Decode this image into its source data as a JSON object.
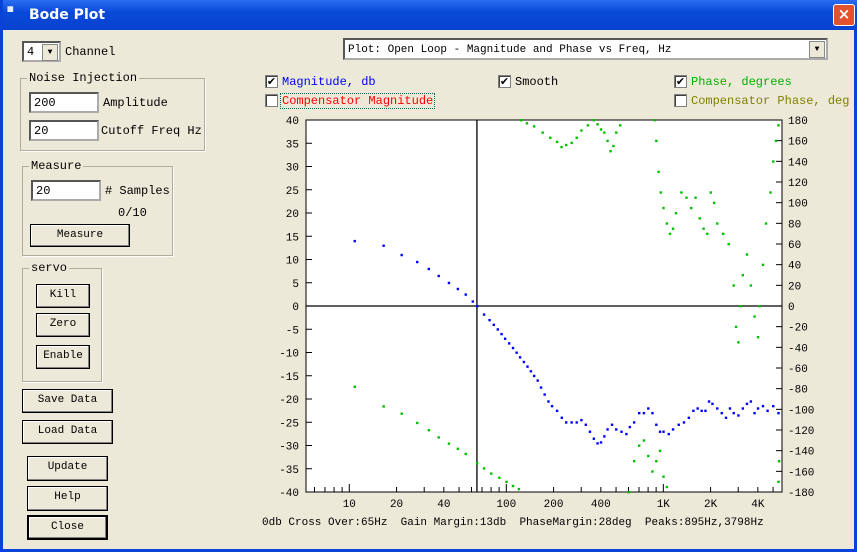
{
  "window": {
    "title": "Bode Plot",
    "icon": "app-icon",
    "close": "×"
  },
  "channel": {
    "value": "4",
    "label": "Channel"
  },
  "noise": {
    "title": "Noise Injection",
    "amplitude": "200",
    "amplitude_label": "Amplitude",
    "cutoff": "20",
    "cutoff_label": "Cutoff Freq Hz"
  },
  "measure": {
    "title": "Measure",
    "samples": "20",
    "samples_label": "# Samples",
    "progress": "0/10",
    "button": "Measure"
  },
  "servo": {
    "title": "servo",
    "kill": "Kill",
    "zero": "Zero",
    "enable": "Enable"
  },
  "buttons": {
    "save": "Save Data",
    "load": "Load Data",
    "update": "Update",
    "help": "Help",
    "close": "Close"
  },
  "plot_select": "Plot: Open Loop - Magnitude and Phase vs Freq, Hz",
  "checks": {
    "magnitude": {
      "label": "Magnitude, db",
      "checked": true,
      "color": "#0000ff"
    },
    "smooth": {
      "label": "Smooth",
      "checked": true,
      "color": "#000000"
    },
    "phase": {
      "label": "Phase, degrees",
      "checked": true,
      "color": "#00b000"
    },
    "comp_mag": {
      "label": "Compensator Magnitude",
      "checked": false,
      "color": "#ff0000"
    },
    "comp_phase": {
      "label": "Compensator Phase, deg",
      "checked": false,
      "color": "#808000"
    }
  },
  "status": "0db Cross Over:65Hz  Gain Margin:13db  PhaseMargin:28deg  Peaks:895Hz,3798Hz",
  "chart_data": {
    "type": "scatter",
    "x_scale": "log",
    "xlim": [
      5.3,
      5700
    ],
    "y_left": {
      "range": [
        -40,
        40
      ],
      "ticks": [
        40,
        35,
        30,
        25,
        20,
        15,
        10,
        5,
        0,
        -5,
        -10,
        -15,
        -20,
        -25,
        -30,
        -35,
        -40
      ]
    },
    "y_right": {
      "range": [
        -180,
        180
      ],
      "ticks": [
        180,
        160,
        140,
        120,
        100,
        80,
        60,
        40,
        20,
        0,
        -20,
        -40,
        -60,
        -80,
        -100,
        -120,
        -140,
        -160,
        -180
      ]
    },
    "x_ticks": [
      {
        "v": 10,
        "l": "10"
      },
      {
        "v": 20,
        "l": "20"
      },
      {
        "v": 40,
        "l": "40"
      },
      {
        "v": 100,
        "l": "100"
      },
      {
        "v": 200,
        "l": "200"
      },
      {
        "v": 400,
        "l": "400"
      },
      {
        "v": 1000,
        "l": "1K"
      },
      {
        "v": 2000,
        "l": "2K"
      },
      {
        "v": 4000,
        "l": "4K"
      }
    ],
    "crosshair": {
      "x": 65,
      "y": 0
    },
    "series": [
      {
        "axis": "left",
        "color": "#0000ff",
        "points": [
          [
            10.8,
            14
          ],
          [
            16.5,
            13
          ],
          [
            21.5,
            11
          ],
          [
            27,
            9.5
          ],
          [
            32,
            8
          ],
          [
            37,
            6.5
          ],
          [
            43,
            5
          ],
          [
            49,
            3.7
          ],
          [
            55,
            2.5
          ],
          [
            61,
            1
          ],
          [
            65,
            0
          ],
          [
            72,
            -1.8
          ],
          [
            78,
            -3
          ],
          [
            83,
            -4
          ],
          [
            88,
            -5
          ],
          [
            93,
            -6
          ],
          [
            98,
            -7
          ],
          [
            104,
            -8
          ],
          [
            110,
            -9
          ],
          [
            116,
            -10
          ],
          [
            122,
            -11
          ],
          [
            129,
            -12
          ],
          [
            136,
            -13
          ],
          [
            143,
            -14
          ],
          [
            150,
            -15
          ],
          [
            158,
            -16
          ],
          [
            166,
            -17.5
          ],
          [
            175,
            -19
          ],
          [
            185,
            -20.5
          ],
          [
            195,
            -21.5
          ],
          [
            210,
            -22.5
          ],
          [
            225,
            -24
          ],
          [
            240,
            -25
          ],
          [
            260,
            -25
          ],
          [
            280,
            -25
          ],
          [
            300,
            -24.5
          ],
          [
            320,
            -25.5
          ],
          [
            340,
            -27
          ],
          [
            360,
            -28.5
          ],
          [
            380,
            -29.5
          ],
          [
            400,
            -29.3
          ],
          [
            420,
            -28
          ],
          [
            440,
            -26.5
          ],
          [
            470,
            -25.5
          ],
          [
            500,
            -26.5
          ],
          [
            540,
            -27
          ],
          [
            580,
            -27.5
          ],
          [
            610,
            -26
          ],
          [
            650,
            -25
          ],
          [
            700,
            -23
          ],
          [
            750,
            -23
          ],
          [
            800,
            -22
          ],
          [
            850,
            -23
          ],
          [
            900,
            -25.5
          ],
          [
            950,
            -27
          ],
          [
            1000,
            -27
          ],
          [
            1080,
            -27.5
          ],
          [
            1150,
            -26.5
          ],
          [
            1250,
            -25.5
          ],
          [
            1350,
            -25
          ],
          [
            1450,
            -24
          ],
          [
            1550,
            -22.5
          ],
          [
            1650,
            -22
          ],
          [
            1750,
            -22.5
          ],
          [
            1850,
            -22.5
          ],
          [
            1950,
            -20.5
          ],
          [
            2050,
            -21
          ],
          [
            2200,
            -22
          ],
          [
            2350,
            -23
          ],
          [
            2500,
            -24
          ],
          [
            2650,
            -22
          ],
          [
            2800,
            -23
          ],
          [
            3000,
            -23.5
          ],
          [
            3200,
            -22
          ],
          [
            3400,
            -21
          ],
          [
            3600,
            -20.5
          ],
          [
            3800,
            -23
          ],
          [
            4000,
            -22
          ],
          [
            4300,
            -21.5
          ],
          [
            4600,
            -22.5
          ],
          [
            5000,
            -21.5
          ],
          [
            5400,
            -23
          ]
        ]
      },
      {
        "axis": "right",
        "color": "#00c000",
        "points": [
          [
            10.8,
            -78
          ],
          [
            16.5,
            -97
          ],
          [
            21.5,
            -104
          ],
          [
            27,
            -113
          ],
          [
            32,
            -120
          ],
          [
            37,
            -127
          ],
          [
            43,
            -133
          ],
          [
            49,
            -138
          ],
          [
            55,
            -143
          ],
          [
            65,
            -152
          ],
          [
            72,
            -157
          ],
          [
            80,
            -162
          ],
          [
            90,
            -166
          ],
          [
            100,
            -170
          ],
          [
            110,
            -174
          ],
          [
            120,
            -177
          ],
          [
            124,
            180
          ],
          [
            135,
            177
          ],
          [
            150,
            174
          ],
          [
            170,
            168
          ],
          [
            190,
            163
          ],
          [
            210,
            159
          ],
          [
            224,
            154
          ],
          [
            240,
            156
          ],
          [
            260,
            158
          ],
          [
            280,
            163
          ],
          [
            300,
            170
          ],
          [
            330,
            175
          ],
          [
            360,
            180
          ],
          [
            380,
            176
          ],
          [
            400,
            171
          ],
          [
            420,
            168
          ],
          [
            440,
            160
          ],
          [
            460,
            150
          ],
          [
            480,
            155
          ],
          [
            500,
            168
          ],
          [
            530,
            175
          ],
          [
            880,
            180
          ],
          [
            900,
            160
          ],
          [
            930,
            130
          ],
          [
            960,
            110
          ],
          [
            1000,
            95
          ],
          [
            1050,
            80
          ],
          [
            1100,
            70
          ],
          [
            1150,
            75
          ],
          [
            1200,
            90
          ],
          [
            1300,
            110
          ],
          [
            1400,
            105
          ],
          [
            1500,
            95
          ],
          [
            1600,
            105
          ],
          [
            1700,
            85
          ],
          [
            1800,
            75
          ],
          [
            1900,
            70
          ],
          [
            2000,
            110
          ],
          [
            2100,
            100
          ],
          [
            2200,
            80
          ],
          [
            2400,
            70
          ],
          [
            2600,
            60
          ],
          [
            2800,
            20
          ],
          [
            2900,
            -20
          ],
          [
            3000,
            -35
          ],
          [
            3100,
            0
          ],
          [
            3200,
            30
          ],
          [
            3400,
            50
          ],
          [
            3600,
            20
          ],
          [
            3800,
            -10
          ],
          [
            4000,
            -30
          ],
          [
            4100,
            0
          ],
          [
            4300,
            40
          ],
          [
            4500,
            80
          ],
          [
            4800,
            110
          ],
          [
            5000,
            140
          ],
          [
            5200,
            160
          ],
          [
            5400,
            175
          ],
          [
            600,
            -180
          ],
          [
            650,
            -150
          ],
          [
            700,
            -135
          ],
          [
            750,
            -130
          ],
          [
            800,
            -145
          ],
          [
            850,
            -160
          ],
          [
            900,
            -150
          ],
          [
            950,
            -140
          ],
          [
            1000,
            -165
          ],
          [
            1050,
            -175
          ],
          [
            5400,
            -170
          ],
          [
            5450,
            -150
          ]
        ]
      }
    ]
  }
}
